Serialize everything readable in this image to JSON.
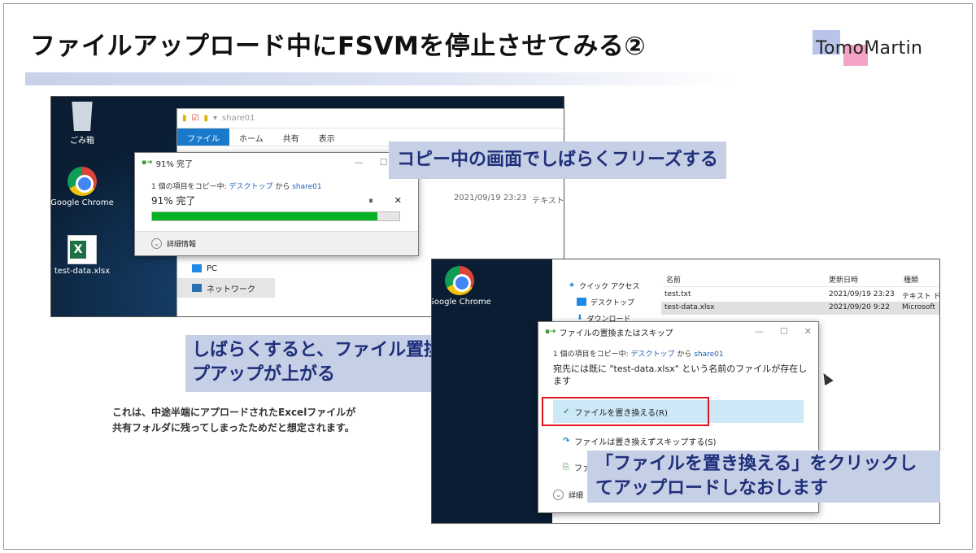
{
  "slide": {
    "title": "ファイルアップロード中にFSVMを停止させてみる②",
    "logo": "TomoMartin"
  },
  "shot1": {
    "desktop_icons": [
      {
        "label": "ごみ箱",
        "icon": "recycle-bin-icon"
      },
      {
        "label": "Google Chrome",
        "icon": "chrome-icon"
      },
      {
        "label": "test-data.xlsx",
        "icon": "excel-file-icon"
      }
    ],
    "explorer": {
      "path": "share01",
      "tabs": [
        "ファイル",
        "ホーム",
        "共有",
        "表示"
      ],
      "date": "2021/09/19 23:23",
      "type": "テキスト ドキ",
      "nav": [
        "PC",
        "ネットワーク"
      ]
    },
    "progress_dialog": {
      "title": "91% 完了",
      "desc_prefix": "1 個の項目をコピー中: ",
      "desc_from": "デスクトップ",
      "desc_mid": " から ",
      "desc_to": "share01",
      "status": "91% 完了",
      "pause": "⏸",
      "cancel": "✕",
      "progress_percent": 91,
      "details": "詳細情報"
    }
  },
  "callout1": "コピー中の画面でしばらくフリーズする",
  "callout2": "しばらくすると、ファイル置換のポップアップが上がる",
  "note": {
    "line1": "これは、中途半端にアプロードされたExcelファイルが",
    "line2": "共有フォルダに残ってしまったためだと想定されます。"
  },
  "shot2": {
    "desktop_icons": [
      {
        "label": "Google Chrome",
        "icon": "chrome-icon"
      }
    ],
    "explorer": {
      "nav": [
        "クイック アクセス",
        "デスクトップ",
        "ダウンロード"
      ],
      "columns": [
        "名前",
        "更新日時",
        "種類"
      ],
      "rows": [
        {
          "name": "test.txt",
          "date": "2021/09/19 23:23",
          "type": "テキスト ドキ"
        },
        {
          "name": "test-data.xlsx",
          "date": "2021/09/20 9:22",
          "type": "Microsoft"
        }
      ]
    },
    "replace_dialog": {
      "title": "ファイルの置換またはスキップ",
      "desc_prefix": "1 個の項目をコピー中: ",
      "desc_from": "デスクトップ",
      "desc_mid": " から ",
      "desc_to": "share01",
      "message": "宛先には既に \"test-data.xlsx\" という名前のファイルが存在します",
      "options": [
        "ファイルを置き換える(R)",
        "ファイルは置き換えずスキップする(S)",
        "ファ"
      ],
      "details": "詳細"
    }
  },
  "callout3": "「ファイルを置き換える」をクリックしてアップロードしなおします"
}
